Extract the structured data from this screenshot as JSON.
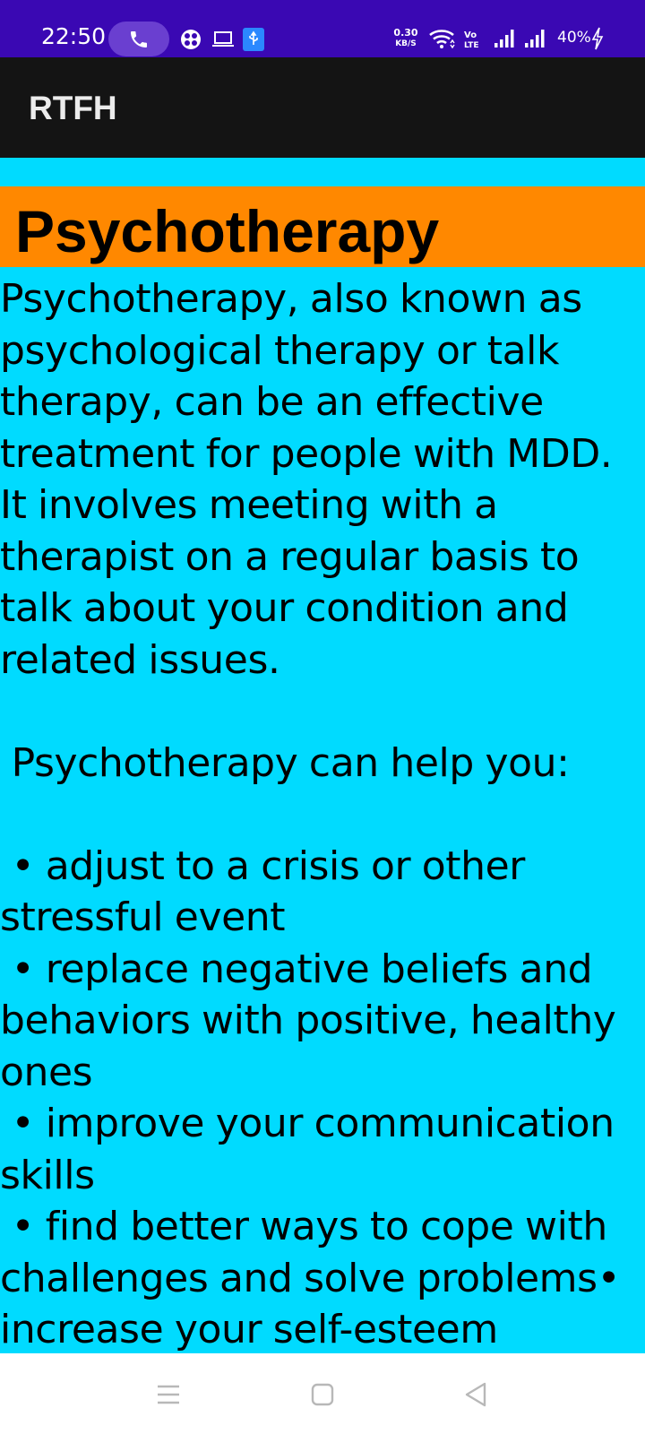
{
  "status_bar": {
    "time": "22:50",
    "net_speed_value": "0.30",
    "net_speed_unit": "KB/S",
    "battery_percent": "40%",
    "icons": [
      "phone-call-icon",
      "app-notification-icon",
      "laptop-icon",
      "usb-icon",
      "wifi-icon",
      "volte-icon",
      "signal-1-icon",
      "signal-2-icon",
      "charging-icon"
    ]
  },
  "app_bar": {
    "title": "RTFH"
  },
  "content": {
    "heading": "Psychotherapy",
    "body": "Psychotherapy, also known as psychological therapy or talk therapy, can be an effective treatment for people with MDD. It involves meeting with a therapist on a regular basis to talk about your condition and related issues.\n\n Psychotherapy can help you:\n\n • adjust to a crisis or other stressful event\n • replace negative beliefs and behaviors with positive, healthy ones\n • improve your communication skills\n • find better ways to cope with challenges and solve problems• increase your self-esteem"
  },
  "nav_bar": {
    "icons": [
      "menu-icon",
      "home-icon",
      "back-icon"
    ]
  },
  "colors": {
    "status_bar": "#3a08b3",
    "app_bar": "#141414",
    "content_bg": "#00dbff",
    "heading_bg": "#ff8800"
  }
}
